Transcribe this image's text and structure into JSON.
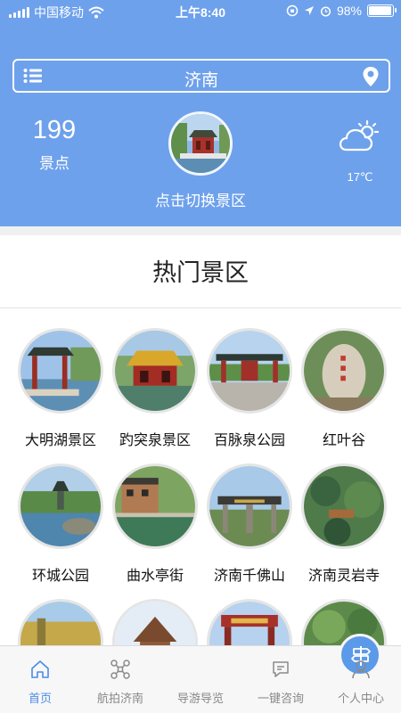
{
  "status_bar": {
    "carrier": "中国移动",
    "time": "上午8:40",
    "battery": "98%",
    "battery_level": 0.98
  },
  "header": {
    "city": "济南",
    "spot_count": "199",
    "spot_count_label": "景点",
    "switch_label": "点击切换景区",
    "temperature": "17℃",
    "weather_icon": "partly-cloudy-icon"
  },
  "section": {
    "title": "热门景区"
  },
  "spots": [
    {
      "name": "大明湖景区"
    },
    {
      "name": "趵突泉景区"
    },
    {
      "name": "百脉泉公园"
    },
    {
      "name": "红叶谷"
    },
    {
      "name": "环城公园"
    },
    {
      "name": "曲水亭街"
    },
    {
      "name": "济南千佛山"
    },
    {
      "name": "济南灵岩寺"
    },
    {
      "name": ""
    },
    {
      "name": ""
    },
    {
      "name": ""
    },
    {
      "name": ""
    }
  ],
  "tabs": [
    {
      "label": "首页",
      "icon": "home-icon",
      "active": true
    },
    {
      "label": "航拍济南",
      "icon": "drone-icon",
      "active": false
    },
    {
      "label": "导游导览",
      "icon": "signpost-icon",
      "active": false
    },
    {
      "label": "一键咨询",
      "icon": "chat-icon",
      "active": false
    },
    {
      "label": "个人中心",
      "icon": "user-icon",
      "active": false
    }
  ],
  "colors": {
    "header_bg": "#6ea1ec",
    "accent": "#4a8ce6"
  }
}
